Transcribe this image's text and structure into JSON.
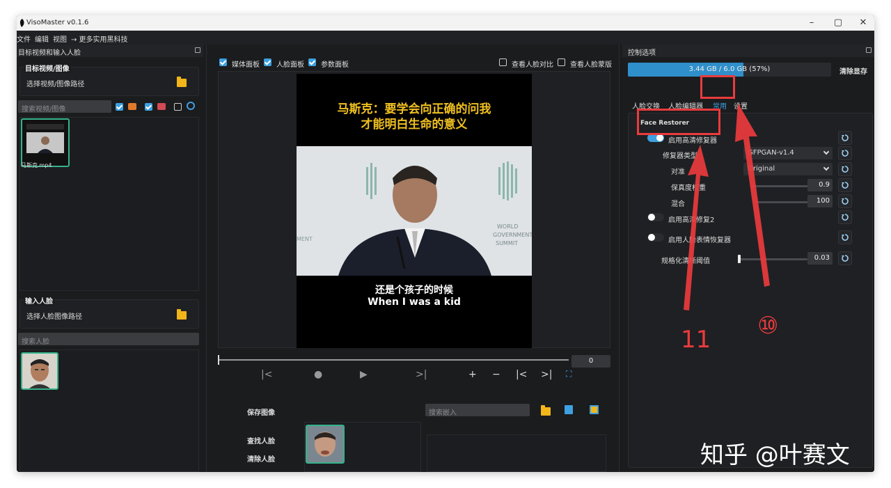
{
  "window": {
    "title": "VisoMaster v0.1.6",
    "controls": [
      "–",
      "▢",
      "✕"
    ]
  },
  "menu": [
    "文件",
    "编辑",
    "视图",
    "→ 更多实用黑科技"
  ],
  "left": {
    "panel_title": "目标视频和输入人脸",
    "target_group_title": "目标视频/图像",
    "target_path_label": "选择视频/图像路径",
    "target_search_placeholder": "搜索视频/图像",
    "target_file_name": "马斯克.mp4",
    "input_group_title": "输入人脸",
    "input_path_label": "选择人脸图像路径",
    "input_search_placeholder": "搜索人脸"
  },
  "center": {
    "check_media": "媒体面板",
    "check_face": "人脸面板",
    "check_params": "参数面板",
    "check_compare": "查看人脸对比",
    "check_mask": "查看人脸蒙版",
    "video_title_line1": "马斯克：要学会向正确的问我",
    "video_title_line2": "才能明白生命的意义",
    "video_sub_cn": "还是个孩子的时候",
    "video_sub_en": "When I was a kid",
    "frame_value": "0",
    "save_image": "保存图像",
    "find_faces": "查找人脸",
    "clear_faces": "清除人脸",
    "embed_search_placeholder": "搜索嵌入"
  },
  "right": {
    "panel_title": "控制选项",
    "vram_text": "3.44 GB / 6.0 GB (57%)",
    "vram_fraction": 0.57,
    "clear_vram": "清除显存",
    "tabs": [
      "人脸交换",
      "人脸编辑器",
      "常用",
      "设置"
    ],
    "section_title": "Face Restorer",
    "enable_restorer": "启用高清修复器",
    "restorer_type_label": "修复器类型",
    "restorer_type_value": "GFPGAN-v1.4",
    "align_label": "对准",
    "align_value": "Original",
    "fidelity_label": "保真度权重",
    "fidelity_value": "0.9",
    "blend_label": "混合",
    "blend_value": "100",
    "enable_restorer2": "启用高清修复2",
    "enable_expression": "启用人脸表情恢复器",
    "norm_label": "规格化清晰阈值",
    "norm_value": "0.03"
  },
  "annotations": {
    "label_11": "11",
    "label_10": "⑩"
  },
  "watermark": "知乎 @叶赛文",
  "colors": {
    "accent": "#3ea0e0",
    "annotation": "#ea3b3d",
    "thumb_border": "#35b38a",
    "folder": "#f2b51a"
  }
}
